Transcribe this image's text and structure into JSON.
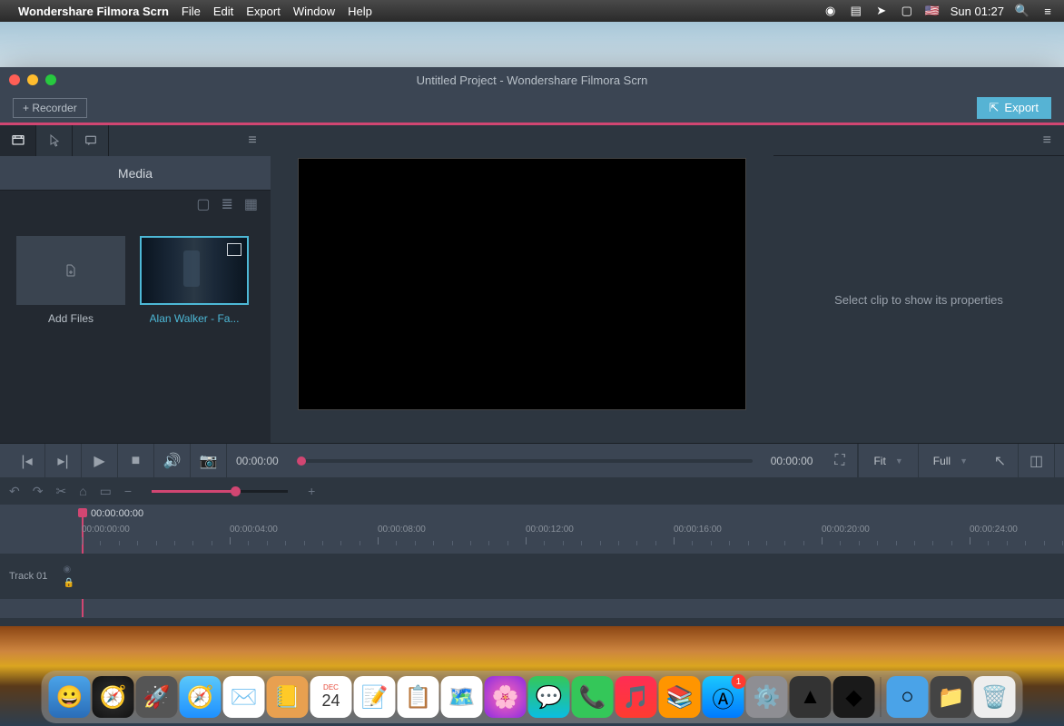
{
  "menubar": {
    "appname": "Wondershare Filmora Scrn",
    "items": [
      "File",
      "Edit",
      "Export",
      "Window",
      "Help"
    ],
    "time": "Sun 01:27"
  },
  "window": {
    "title": "Untitled Project - Wondershare Filmora Scrn",
    "recorder_btn": "+ Recorder",
    "export_btn": "Export"
  },
  "media_panel": {
    "tab_label": "Media",
    "add_files": "Add Files",
    "clip_name": "Alan Walker - Fa..."
  },
  "properties": {
    "placeholder": "Select clip to show its properties"
  },
  "playbar": {
    "time_current": "00:00:00",
    "time_total": "00:00:00",
    "fit": "Fit",
    "full": "Full"
  },
  "timeline": {
    "playhead_time": "00:00:00:00",
    "ticks": [
      "00:00:00:00",
      "00:00:04:00",
      "00:00:08:00",
      "00:00:12:00",
      "00:00:16:00",
      "00:00:20:00",
      "00:00:24:00"
    ],
    "track_label": "Track 01"
  },
  "dock": {
    "badge": "1"
  }
}
